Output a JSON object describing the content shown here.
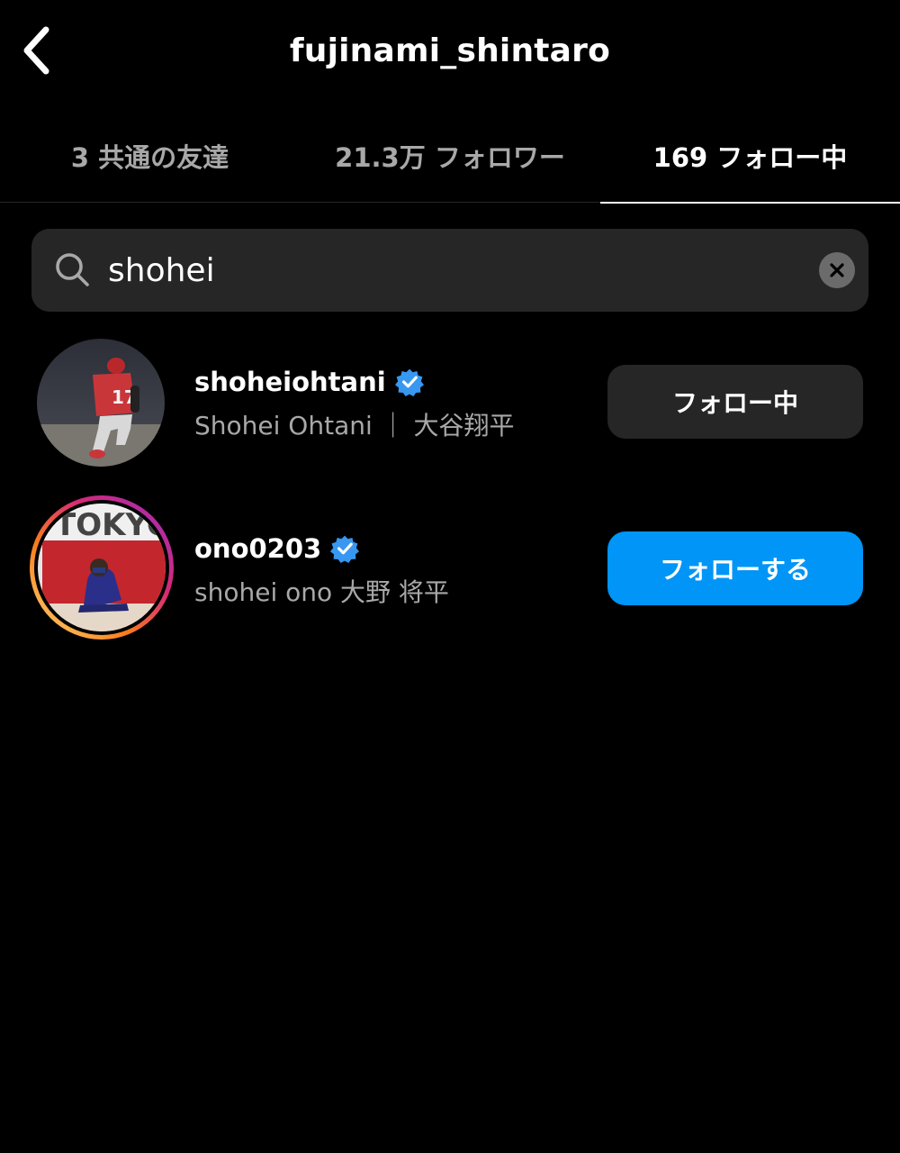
{
  "header": {
    "title": "fujinami_shintaro"
  },
  "tabs": [
    {
      "label": "3 共通の友達"
    },
    {
      "label": "21.3万 フォロワー"
    },
    {
      "label": "169 フォロー中"
    }
  ],
  "search": {
    "value": "shohei",
    "placeholder": "検索"
  },
  "results": [
    {
      "username": "shoheiohtani",
      "fullname": "Shohei Ohtani ｜ 大谷翔平",
      "verified": true,
      "button": "フォロー中",
      "avatar_has_story_ring": false
    },
    {
      "username": "ono0203",
      "fullname": "shohei ono  大野 将平",
      "verified": true,
      "button": "フォローする",
      "avatar_has_story_ring": true
    }
  ],
  "colors": {
    "background": "#000000",
    "accent": "#0095f6",
    "verified": "#3897f0",
    "muted_text": "#a8a8a8",
    "surface": "#262626"
  }
}
